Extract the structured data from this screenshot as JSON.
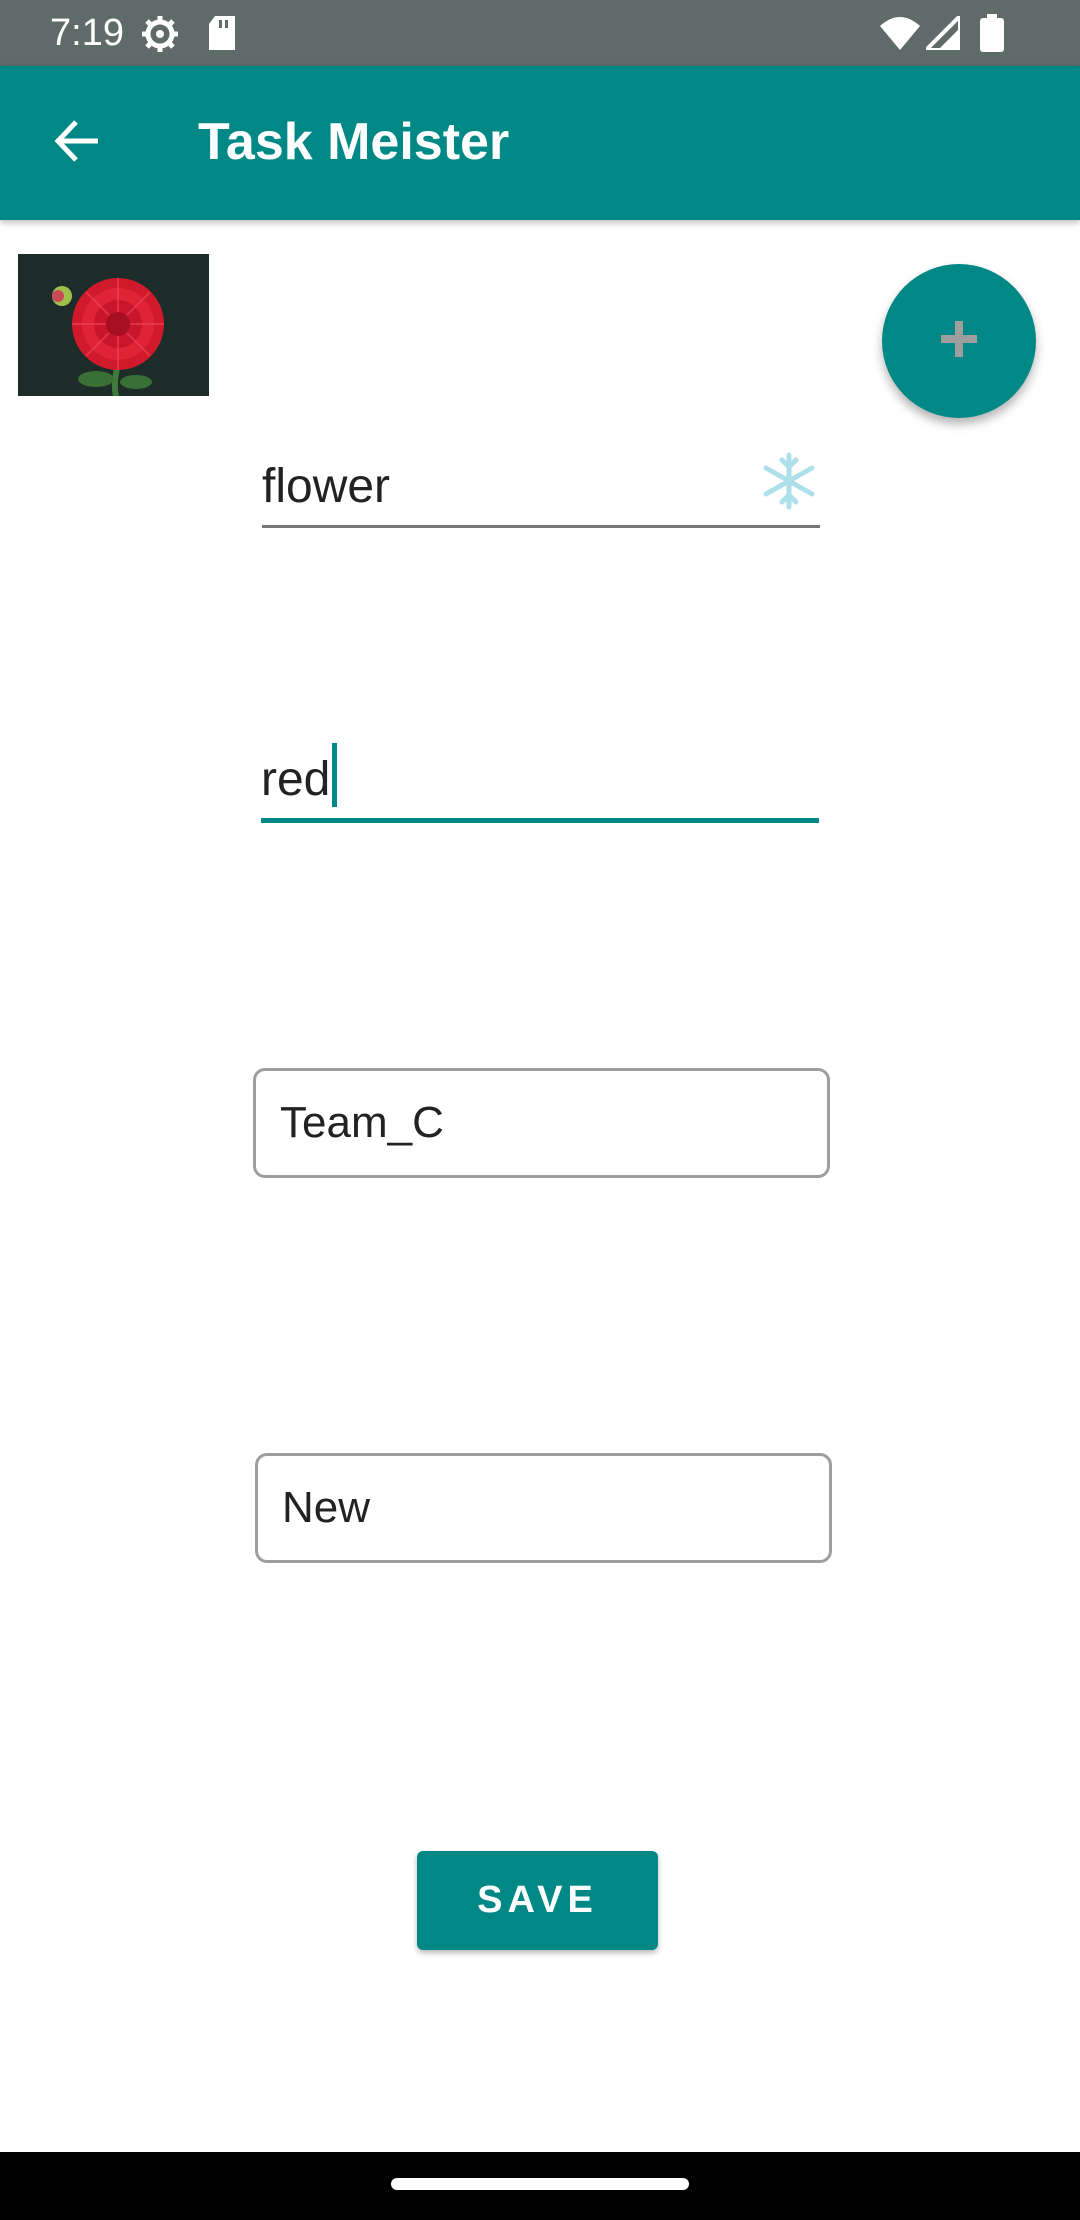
{
  "status_bar": {
    "time": "7:19",
    "icons": [
      "settings-icon",
      "sd-card-icon",
      "wifi-icon",
      "signal-icon",
      "battery-icon"
    ],
    "background": "#5f6b68"
  },
  "app_bar": {
    "title": "Task Meister",
    "back_icon": "arrow-back-icon",
    "background": "#008887"
  },
  "thumbnail": {
    "icon": "flower-photo"
  },
  "fab": {
    "icon": "plus-icon",
    "color": "#008887"
  },
  "form": {
    "name_field": {
      "value": "flower",
      "icon": "snowflake-icon"
    },
    "color_field": {
      "value": "red"
    },
    "team_field": {
      "value": "Team_C"
    },
    "status_field": {
      "value": "New"
    }
  },
  "save_button": {
    "label": "SAVE"
  }
}
